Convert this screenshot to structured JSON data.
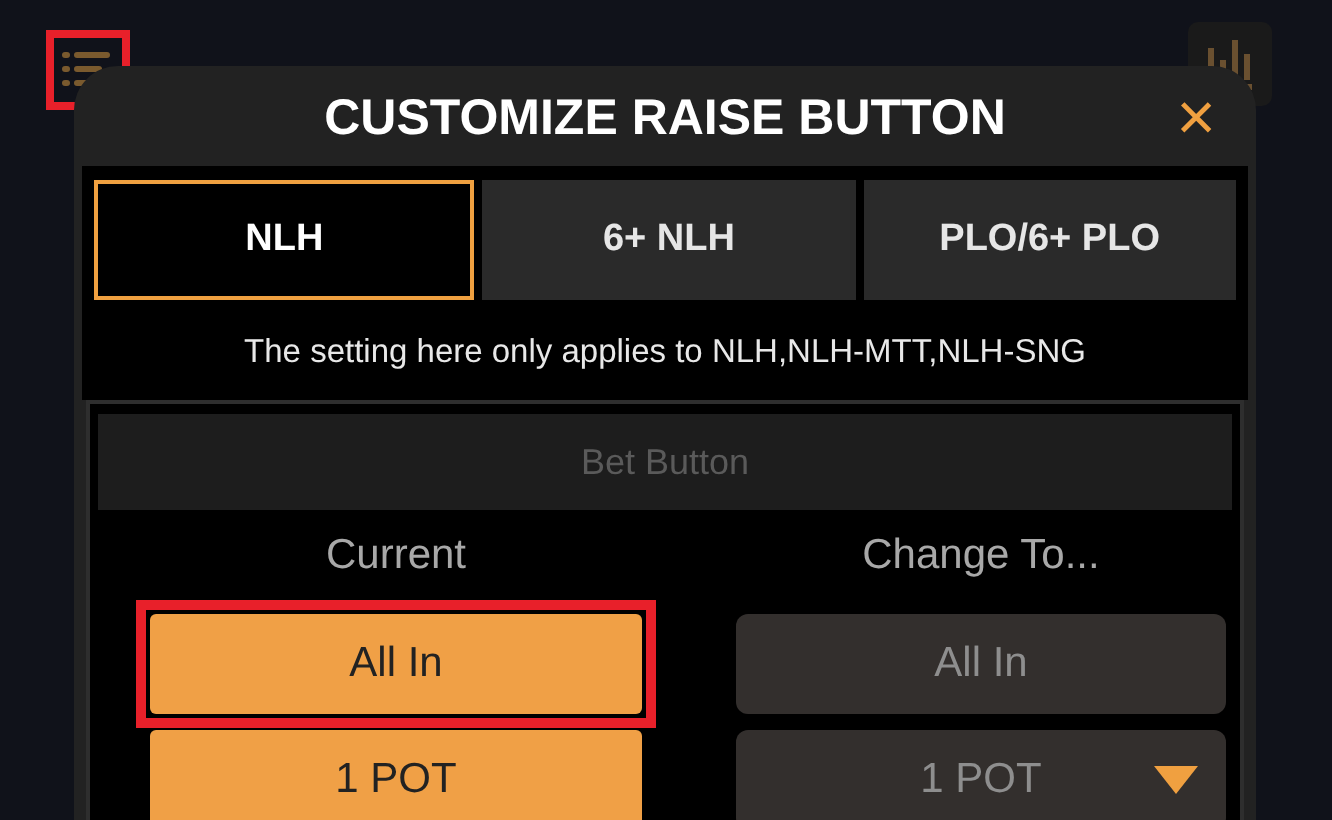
{
  "menu_button": {
    "highlighted": true
  },
  "dialog": {
    "title": "CUSTOMIZE RAISE BUTTON",
    "close": "×"
  },
  "tabs": [
    {
      "label": "NLH",
      "selected": true
    },
    {
      "label": "6+ NLH",
      "selected": false
    },
    {
      "label": "PLO/6+ PLO",
      "selected": false
    }
  ],
  "note": "The setting here only applies to NLH,NLH-MTT,NLH-SNG",
  "section": {
    "title": "Bet Button"
  },
  "current": {
    "heading": "Current",
    "options": [
      {
        "label": "All In",
        "highlighted": true
      },
      {
        "label": "1 POT",
        "highlighted": false
      }
    ]
  },
  "change_to": {
    "heading": "Change To...",
    "options": [
      {
        "label": "All In",
        "kind": "plain"
      },
      {
        "label": "1 POT",
        "kind": "dropdown"
      }
    ]
  }
}
